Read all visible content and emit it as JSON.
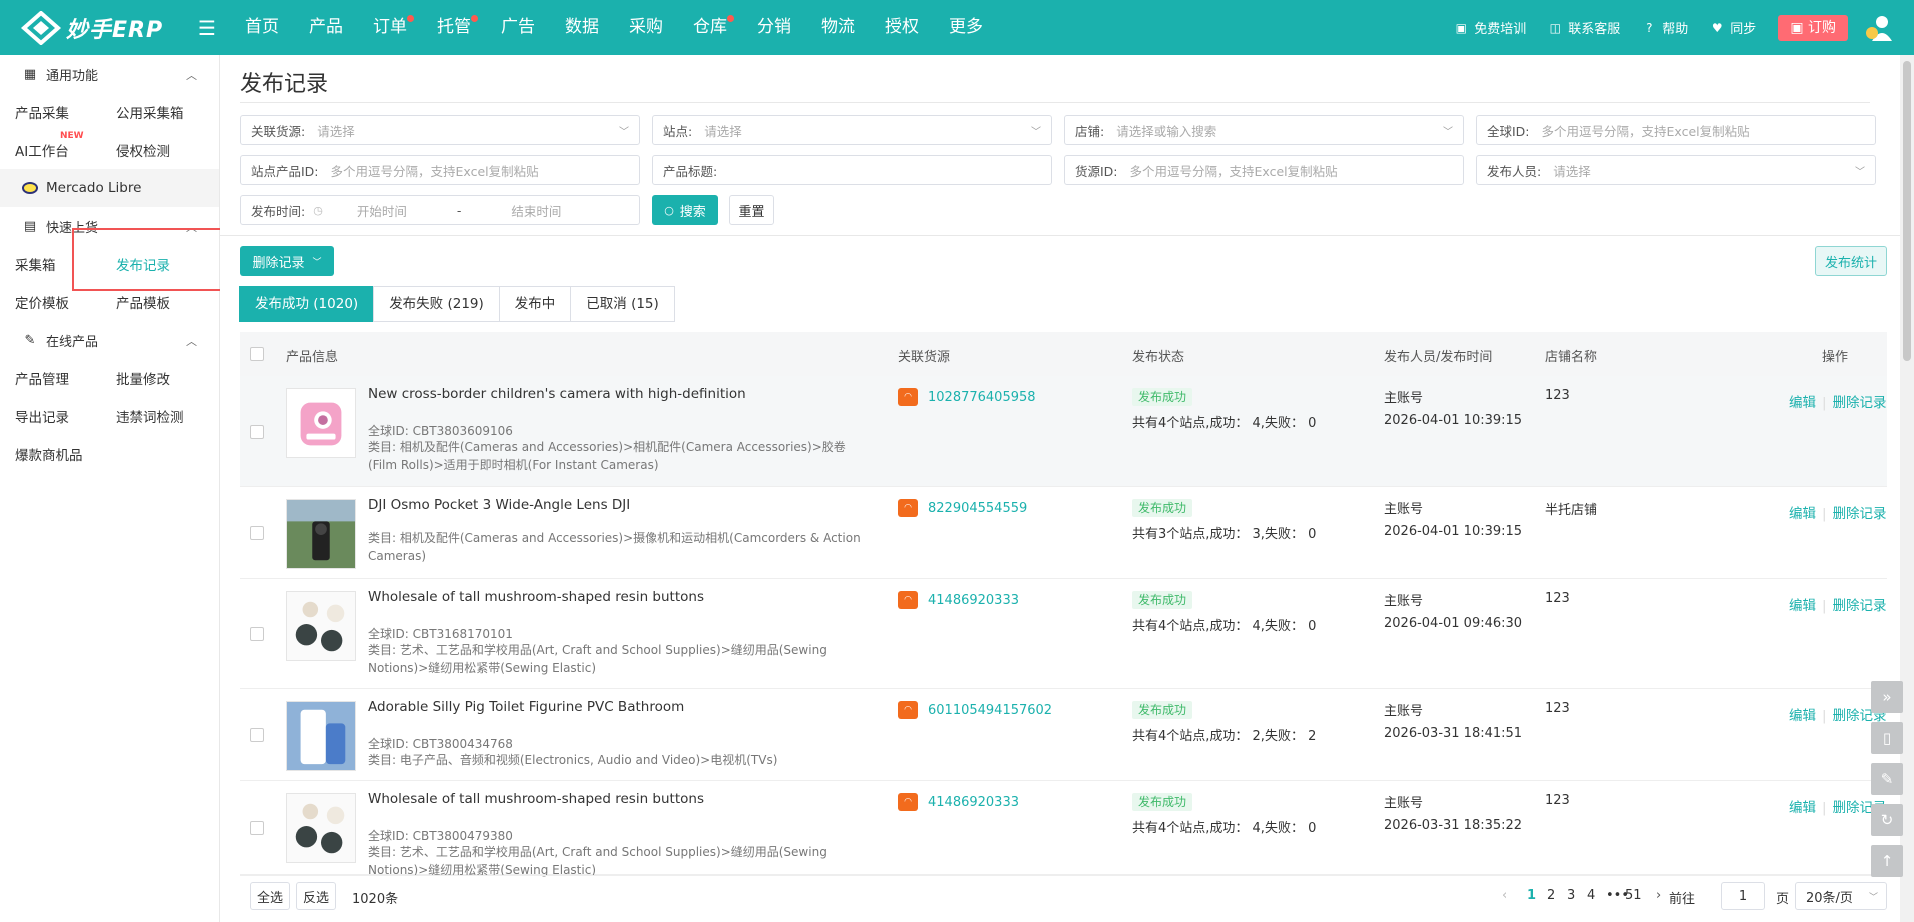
{
  "app": {
    "logo_text": "妙手ERP"
  },
  "nav": [
    "首页",
    "产品",
    "订单",
    "托管",
    "广告",
    "数据",
    "采购",
    "仓库",
    "分销",
    "物流",
    "授权",
    "更多"
  ],
  "nav_dots": [
    false,
    false,
    true,
    true,
    false,
    false,
    false,
    true,
    false,
    false,
    false,
    false
  ],
  "top_right": {
    "training": "免费培训",
    "support": "联系客服",
    "help": "帮助",
    "sync": "同步",
    "order": "订购"
  },
  "sidebar": {
    "group1": "通用功能",
    "row1": [
      "产品采集",
      "公用采集箱"
    ],
    "row2": [
      "AI工作台",
      "侵权检测"
    ],
    "new_tag": "NEW",
    "platform": "Mercado Libre",
    "group2": "快速上货",
    "row3": [
      "采集箱",
      "发布记录"
    ],
    "row4": [
      "定价模板",
      "产品模板"
    ],
    "group3": "在线产品",
    "row5": [
      "产品管理",
      "批量修改"
    ],
    "row6": [
      "导出记录",
      "违禁词检测"
    ],
    "row7": [
      "爆款商机品"
    ]
  },
  "page": {
    "title": "发布记录"
  },
  "filters": {
    "source_label": "关联货源:",
    "source_ph": "请选择",
    "site_label": "站点:",
    "site_ph": "请选择",
    "shop_label": "店铺:",
    "shop_ph": "请选择或输入搜索",
    "gid_label": "全球ID:",
    "gid_ph": "多个用逗号分隔，支持Excel复制粘贴",
    "spid_label": "站点产品ID:",
    "spid_ph": "多个用逗号分隔，支持Excel复制粘贴",
    "ptitle_label": "产品标题:",
    "srcid_label": "货源ID:",
    "srcid_ph": "多个用逗号分隔，支持Excel复制粘贴",
    "publisher_label": "发布人员:",
    "publisher_ph": "请选择",
    "time_label": "发布时间:",
    "start_ph": "开始时间",
    "dash": "-",
    "end_ph": "结束时间",
    "search": "搜索",
    "reset": "重置"
  },
  "actions": {
    "delete_records": "删除记录",
    "stats": "发布统计"
  },
  "tabs": [
    "发布成功 (1020)",
    "发布失败 (219)",
    "发布中",
    "已取消 (15)"
  ],
  "table": {
    "headers": {
      "product": "产品信息",
      "source": "关联货源",
      "status": "发布状态",
      "publisher": "发布人员/发布时间",
      "shop": "店铺名称",
      "ops": "操作"
    },
    "rows": [
      {
        "title": "New cross-border children's camera with high-definition",
        "gid": "全球ID: CBT3803609106",
        "category": "类目: 相机及配件(Cameras and Accessories)>相机配件(Camera Accessories)>胶卷(Film Rolls)>适用于即时相机(For Instant Cameras)",
        "source_id": "1028776405958",
        "source_icon": "1688",
        "status": "发布成功",
        "status_text": "共有4个站点,成功： 4,失败： 0",
        "publisher": "主账号",
        "time": "2026-04-01 10:39:15",
        "shop": "123",
        "edit": "编辑",
        "delete": "删除记录"
      },
      {
        "title": "DJI Osmo Pocket 3 Wide-Angle Lens DJI",
        "gid": "",
        "category": "类目: 相机及配件(Cameras and Accessories)>摄像机和运动相机(Camcorders & Action Cameras)",
        "source_id": "822904554559",
        "source_icon": "1688",
        "status": "发布成功",
        "status_text": "共有3个站点,成功： 3,失败： 0",
        "publisher": "主账号",
        "time": "2026-04-01 10:39:15",
        "shop": "半托店铺",
        "edit": "编辑",
        "delete": "删除记录"
      },
      {
        "title": "Wholesale of tall mushroom-shaped resin buttons",
        "gid": "全球ID: CBT3168170101",
        "category": "类目: 艺术、工艺品和学校用品(Art, Craft and School Supplies)>缝纫用品(Sewing Notions)>缝纫用松紧带(Sewing Elastic)",
        "source_id": "41486920333",
        "source_icon": "1688",
        "status": "发布成功",
        "status_text": "共有4个站点,成功： 4,失败： 0",
        "publisher": "主账号",
        "time": "2026-04-01 09:46:30",
        "shop": "123",
        "edit": "编辑",
        "delete": "删除记录"
      },
      {
        "title": "Adorable Silly Pig Toilet Figurine PVC Bathroom",
        "gid": "全球ID: CBT3800434768",
        "category": "类目: 电子产品、音频和视频(Electronics, Audio and Video)>电视机(TVs)",
        "source_id": "601105494157602",
        "source_icon": "淘宝",
        "status": "发布成功",
        "status_text": "共有4个站点,成功： 2,失败： 2",
        "publisher": "主账号",
        "time": "2026-03-31 18:41:51",
        "shop": "123",
        "edit": "编辑",
        "delete": "删除记录"
      },
      {
        "title": "Wholesale of tall mushroom-shaped resin buttons",
        "gid": "全球ID: CBT3800479380",
        "category": "类目: 艺术、工艺品和学校用品(Art, Craft and School Supplies)>缝纫用品(Sewing Notions)>缝纫用松紧带(Sewing Elastic)",
        "source_id": "41486920333",
        "source_icon": "1688",
        "status": "发布成功",
        "status_text": "共有4个站点,成功： 4,失败： 0",
        "publisher": "主账号",
        "time": "2026-03-31 18:35:22",
        "shop": "123",
        "edit": "编辑",
        "delete": "删除记录"
      }
    ]
  },
  "footer": {
    "select_all": "全选",
    "invert": "反选",
    "total": "1020条",
    "pages": [
      "1",
      "2",
      "3",
      "4",
      "•••",
      "51"
    ],
    "goto_label": "前往",
    "goto_value": "1",
    "page_unit": "页",
    "page_size": "20条/页"
  },
  "colors": {
    "accent": "#1bb1ad",
    "order_btn": "#ff6b73",
    "highlight_box": "#f15454",
    "success_bg": "#e8f7ee",
    "success_text": "#3fba6a"
  }
}
